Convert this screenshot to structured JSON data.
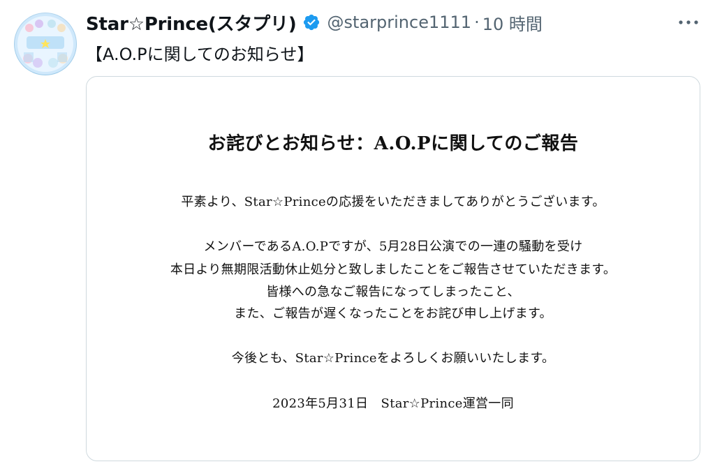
{
  "account": {
    "display_name": "Star☆Prince(スタプリ)",
    "handle": "@starprince1111",
    "separator": "·",
    "time": "10 時間",
    "verified_color": "#1d9bf0"
  },
  "tweet": {
    "text": "【A.O.Pに関してのお知らせ】"
  },
  "notice": {
    "title": "お詫びとお知らせ：A.O.Pに関してのご報告",
    "greeting": "平素より、Star☆Princeの応援をいただきましてありがとうございます。",
    "body": [
      "メンバーであるA.O.Pですが、5月28日公演での一連の騒動を受け",
      "本日より無期限活動休止処分と致しましたことをご報告させていただきます。",
      "皆様への急なご報告になってしまったこと、",
      "また、ご報告が遅くなったことをお詫び申し上げます。"
    ],
    "closing": "今後とも、Star☆Princeをよろしくお願いいたします。",
    "signature": "2023年5月31日　Star☆Prince運営一同"
  },
  "icons": {
    "verified": "verified-badge-icon",
    "more": "more-dots-icon"
  }
}
